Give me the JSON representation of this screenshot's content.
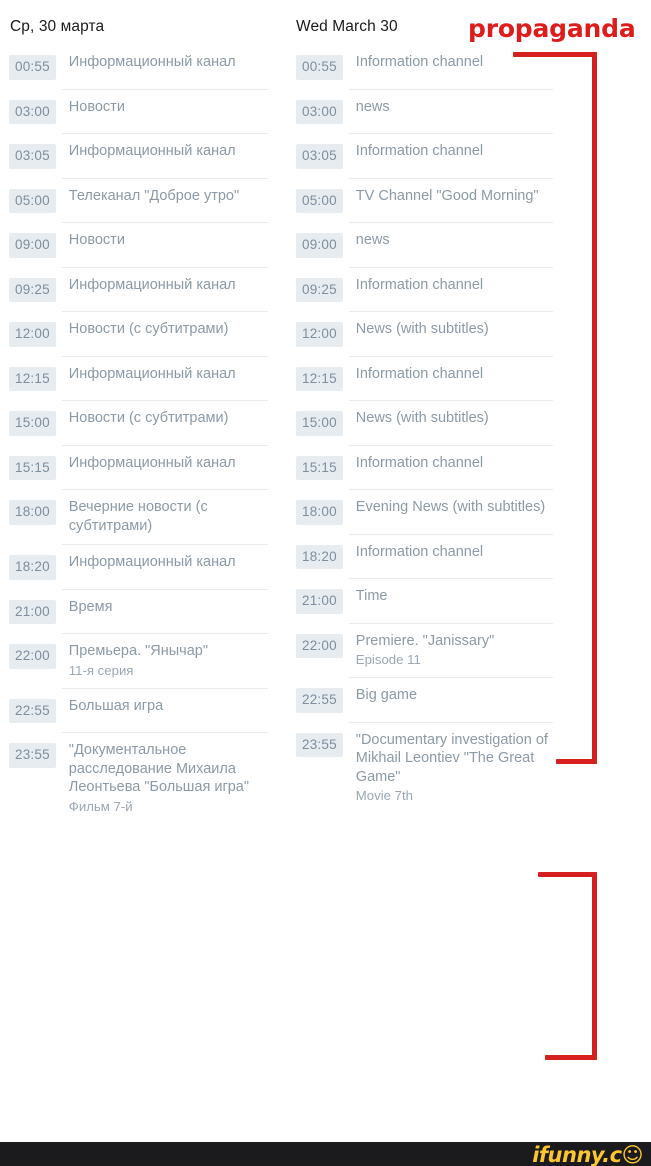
{
  "columns": {
    "russian": {
      "header": "Ср, 30 марта",
      "rows": [
        {
          "time": "00:55",
          "title": "Информационный канал"
        },
        {
          "time": "03:00",
          "title": "Новости"
        },
        {
          "time": "03:05",
          "title": "Информационный канал"
        },
        {
          "time": "05:00",
          "title": "Телеканал \"Доброе утро\""
        },
        {
          "time": "09:00",
          "title": "Новости"
        },
        {
          "time": "09:25",
          "title": "Информационный канал"
        },
        {
          "time": "12:00",
          "title": "Новости (с субтитрами)"
        },
        {
          "time": "12:15",
          "title": "Информационный канал"
        },
        {
          "time": "15:00",
          "title": "Новости (с субтитрами)"
        },
        {
          "time": "15:15",
          "title": "Информационный канал"
        },
        {
          "time": "18:00",
          "title": "Вечерние новости (с субтитрами)"
        },
        {
          "time": "18:20",
          "title": "Информационный канал"
        },
        {
          "time": "21:00",
          "title": "Время"
        },
        {
          "time": "22:00",
          "title": "Премьера. \"Янычар\"",
          "subtitle": "11-я серия"
        },
        {
          "time": "22:55",
          "title": "Большая игра"
        },
        {
          "time": "23:55",
          "title": "\"Документальное расследование Михаила Леонтьева \"Большая игра\"",
          "subtitle": "Фильм 7-й"
        }
      ]
    },
    "english": {
      "header": "Wed March 30",
      "rows": [
        {
          "time": "00:55",
          "title": "Information channel"
        },
        {
          "time": "03:00",
          "title": "news"
        },
        {
          "time": "03:05",
          "title": "Information channel"
        },
        {
          "time": "05:00",
          "title": "TV Channel \"Good Morning\""
        },
        {
          "time": "09:00",
          "title": "news"
        },
        {
          "time": "09:25",
          "title": "Information channel"
        },
        {
          "time": "12:00",
          "title": "News (with subtitles)"
        },
        {
          "time": "12:15",
          "title": "Information channel"
        },
        {
          "time": "15:00",
          "title": "News (with subtitles)"
        },
        {
          "time": "15:15",
          "title": "Information channel"
        },
        {
          "time": "18:00",
          "title": "Evening News (with subtitles)"
        },
        {
          "time": "18:20",
          "title": "Information channel"
        },
        {
          "time": "21:00",
          "title": "Time"
        },
        {
          "time": "22:00",
          "title": "Premiere. \"Janissary\"",
          "subtitle": "Episode 11"
        },
        {
          "time": "22:55",
          "title": "Big game"
        },
        {
          "time": "23:55",
          "title": "\"Documentary investigation of Mikhail Leontiev \"The Great Game\"",
          "subtitle": "Movie 7th"
        }
      ]
    }
  },
  "annotation": {
    "label": "propaganda",
    "color": "#e01b1b"
  },
  "watermark": {
    "text": "ifunny.c",
    "smiley": "☺",
    "text_color": "#fbc630",
    "bar_color": "#1b1a1c"
  },
  "theme": {
    "time_badge_bg": "#e7ecf1",
    "time_badge_text": "#7e8e9c",
    "title_text": "#8c9aa6",
    "header_text": "#1b1b1b",
    "divider": "#e6ebef"
  }
}
